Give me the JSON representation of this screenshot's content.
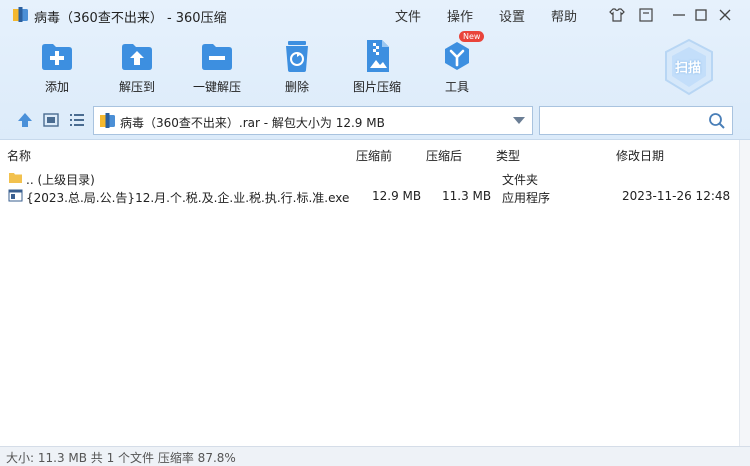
{
  "window": {
    "title": "病毒（360查不出来） - 360压缩",
    "menu": [
      "文件",
      "操作",
      "设置",
      "帮助"
    ]
  },
  "toolbar": {
    "items": [
      {
        "label": "添加",
        "icon": "add-icon"
      },
      {
        "label": "解压到",
        "icon": "extract-to-icon"
      },
      {
        "label": "一键解压",
        "icon": "one-click-extract-icon"
      },
      {
        "label": "删除",
        "icon": "delete-icon"
      },
      {
        "label": "图片压缩",
        "icon": "image-compress-icon"
      },
      {
        "label": "工具",
        "icon": "tools-icon",
        "badge": "New"
      }
    ],
    "scan_label": "扫描"
  },
  "addressbar": {
    "path": "病毒（360查不出来）.rar - 解包大小为 12.9 MB",
    "search_placeholder": ""
  },
  "list": {
    "columns": {
      "name": "名称",
      "compressed_before": "压缩前",
      "compressed_after": "压缩后",
      "type": "类型",
      "modified": "修改日期"
    },
    "rows": [
      {
        "name": ".. (上级目录)",
        "before": "",
        "after": "",
        "type": "文件夹",
        "date": "",
        "icon": "folder-icon"
      },
      {
        "name": "{2023.总.局.公.告}12.月.个.税.及.企.业.税.执.行.标.准.exe",
        "before": "12.9 MB",
        "after": "11.3 MB",
        "type": "应用程序",
        "date": "2023-11-26 12:48",
        "icon": "exe-icon"
      }
    ]
  },
  "status": {
    "text": "大小: 11.3 MB 共 1 个文件 压缩率 87.8%"
  },
  "colors": {
    "accent": "#2f8ee5",
    "toolbar_bg": "#e3effb",
    "badge": "#e9443b"
  }
}
